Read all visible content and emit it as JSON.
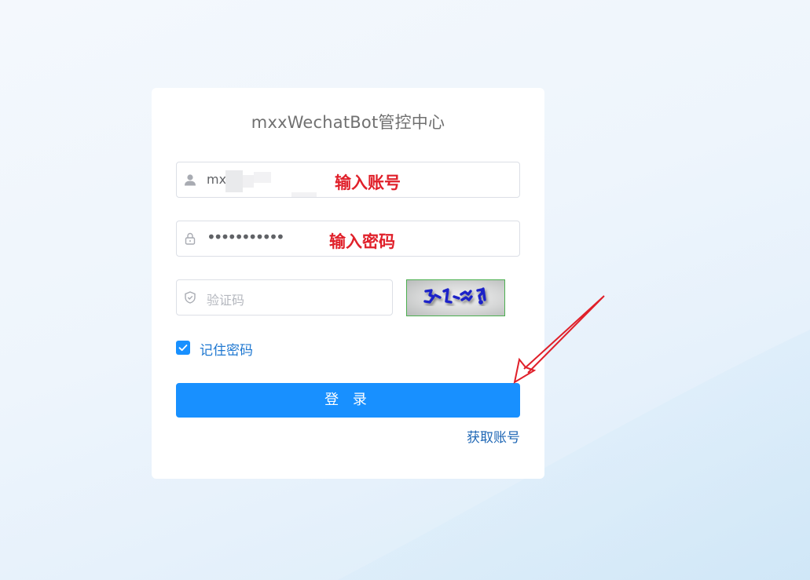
{
  "app": {
    "title": "mxxWechatBot管控中心"
  },
  "form": {
    "username_value": "mx",
    "username_annotation": "输入账号",
    "password_value": "•••••••••••",
    "password_annotation": "输入密码",
    "captcha_placeholder": "验证码",
    "remember_label": "记住密码",
    "remember_checked": true,
    "login_label": "登 录",
    "get_account_label": "获取账号"
  },
  "icons": {
    "username": "user-icon",
    "password": "lock-icon",
    "captcha": "shield-icon",
    "remember": "check-icon"
  },
  "colors": {
    "primary": "#1890ff",
    "annotation": "#e0202a",
    "link": "#1f67b5"
  }
}
